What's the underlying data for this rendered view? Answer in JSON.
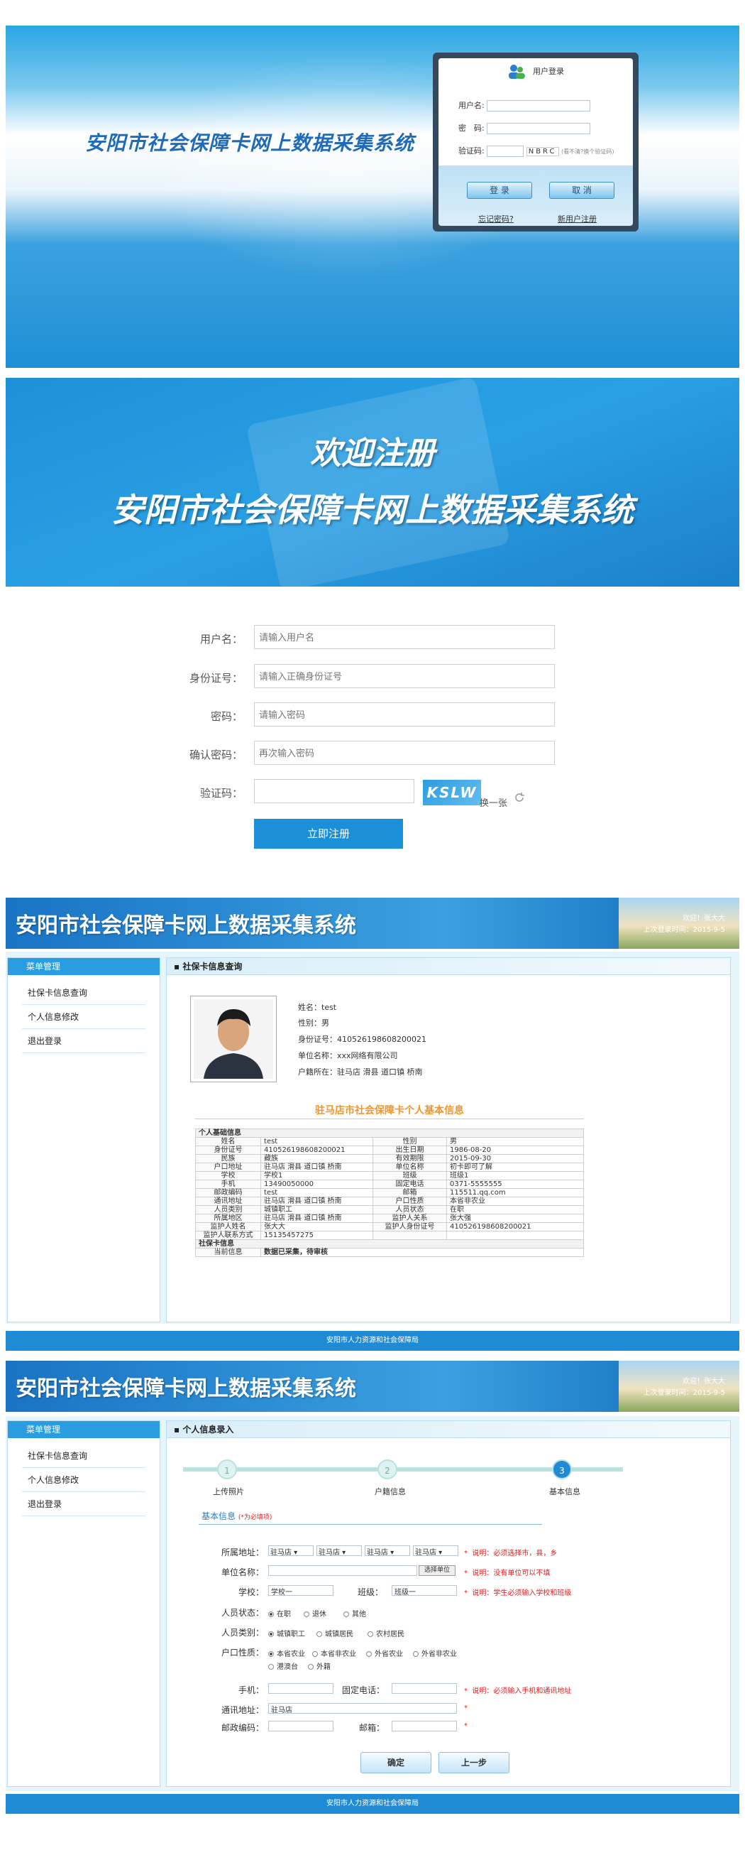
{
  "login": {
    "title": "安阳市社会保障卡网上数据采集系统",
    "box_title": "用户登录",
    "username_label": "用户名:",
    "password_label": "密　码:",
    "captcha_label": "验证码:",
    "captcha_text": "NBRC",
    "captcha_hint": "(看不清?换个验证码)",
    "login_button": "登 录",
    "cancel_button": "取 消",
    "forgot_link": "忘记密码?",
    "register_link": "新用户注册"
  },
  "register": {
    "banner_line1": "欢迎注册",
    "banner_line2": "安阳市社会保障卡网上数据采集系统",
    "fields": [
      {
        "label": "用户名：",
        "placeholder": "请输入用户名"
      },
      {
        "label": "身份证号：",
        "placeholder": "请输入正确身份证号"
      },
      {
        "label": "密码：",
        "placeholder": "请输入密码"
      },
      {
        "label": "确认密码：",
        "placeholder": "再次输入密码"
      }
    ],
    "captcha_label": "验证码：",
    "captcha_image_text": "KSLW",
    "refresh_text": "换一张",
    "submit_button": "立即注册"
  },
  "system": {
    "title": "安阳市社会保障卡网上数据采集系统",
    "welcome": "欢迎！张大大",
    "last_login": "上次登录时间：2015-9-5",
    "menu_head": "菜单管理",
    "menu": [
      "社保卡信息查询",
      "个人信息修改",
      "退出登录"
    ],
    "footer": "安阳市人力资源和社会保障局"
  },
  "info_page": {
    "panel_title": "社保卡信息查询",
    "profile": [
      "姓名：test",
      "性别：男",
      "身份证号：410526198608200021",
      "单位名称：xxx网络有限公司",
      "户籍所在：驻马店 滑县 道口镇 桥南"
    ],
    "table_title": "驻马店市社会保障卡个人基本信息",
    "section_basic": "个人基础信息",
    "rows": [
      [
        "姓名",
        "test",
        "性别",
        "男"
      ],
      [
        "身份证号",
        "410526198608200021",
        "出生日期",
        "1986-08-20"
      ],
      [
        "民族",
        "藏族",
        "有效期限",
        "2015-09-30"
      ],
      [
        "户口地址",
        "驻马店 滑县 道口镇 桥南",
        "单位名称",
        "初卡即可了解"
      ],
      [
        "学校",
        "学校1",
        "班级",
        "班级1"
      ],
      [
        "手机",
        "13490050000",
        "固定电话",
        "0371-5555555"
      ],
      [
        "邮政编码",
        "test",
        "邮箱",
        "115511.qq.com"
      ],
      [
        "通讯地址",
        "驻马店 滑县 道口镇 桥南",
        "户口性质",
        "本省非农业"
      ],
      [
        "人员类别",
        "城镇职工",
        "人员状态",
        "在职"
      ],
      [
        "所属地区",
        "驻马店 滑县 道口镇 桥南",
        "监护人关系",
        "张大强"
      ],
      [
        "监护人姓名",
        "张大大",
        "监护人身份证号",
        "410526198608200021"
      ],
      [
        "监护人联系方式",
        "15135457275",
        "",
        ""
      ]
    ],
    "section_card": "社保卡信息",
    "status_label": "当前信息",
    "status_value": "数据已采集，待审核"
  },
  "form_page": {
    "panel_title": "个人信息录入",
    "steps": [
      {
        "num": "1",
        "label": "上传照片"
      },
      {
        "num": "2",
        "label": "户籍信息"
      },
      {
        "num": "3",
        "label": "基本信息"
      }
    ],
    "section_title": "基本信息",
    "section_hint": "(*为必填项)",
    "area_label": "所属地址：",
    "area_selects": [
      "驻马店",
      "驻马店",
      "驻马店",
      "驻马店"
    ],
    "area_note": "说明：必须选择市，县，乡",
    "unit_label": "单位名称：",
    "unit_button": "选择单位",
    "unit_note": "说明：没有单位可以不填",
    "school_label": "学校：",
    "school_value": "学校一",
    "class_label": "班级：",
    "class_value": "班级一",
    "school_note": "说明：学生必须输入学校和班级",
    "status_label": "人员状态：",
    "status_options": [
      "在职",
      "退休",
      "其他"
    ],
    "category_label": "人员类别：",
    "category_options": [
      "城镇职工",
      "城镇居民",
      "农村居民"
    ],
    "hukou_label": "户口性质：",
    "hukou_options": [
      "本省农业",
      "本省非农业",
      "外省农业",
      "外省非农业",
      "港澳台",
      "外籍"
    ],
    "mobile_label": "手机：",
    "phone_label": "固定电话：",
    "phone_note": "说明：必须输入手机和通讯地址",
    "address_label": "通讯地址：",
    "address_value": "驻马店",
    "zip_label": "邮政编码：",
    "email_label": "邮箱：",
    "star": "*",
    "confirm_button": "确定",
    "prev_button": "上一步"
  }
}
